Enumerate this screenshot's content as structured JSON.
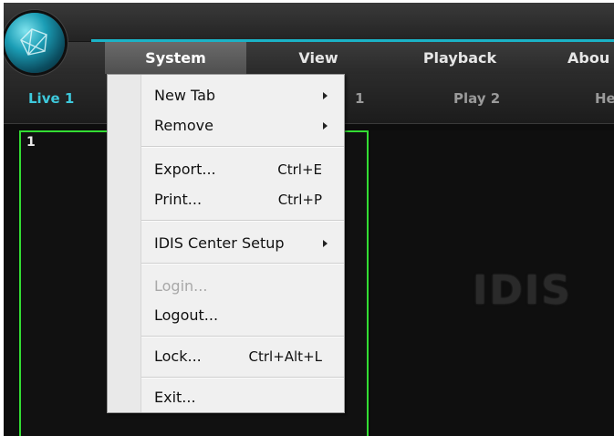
{
  "menubar": {
    "items": [
      {
        "label": "System"
      },
      {
        "label": "View"
      },
      {
        "label": "Playback"
      },
      {
        "label": "Abou"
      }
    ]
  },
  "tabs": [
    {
      "label": "Live 1"
    },
    {
      "label": "1"
    },
    {
      "label": "Play 2"
    },
    {
      "label": "He"
    }
  ],
  "video": {
    "cell_number": "1",
    "watermark": "IDIS"
  },
  "system_menu": {
    "items": [
      {
        "label": "New Tab",
        "shortcut": ""
      },
      {
        "label": "Remove",
        "shortcut": ""
      },
      {
        "label": "Export...",
        "shortcut": "Ctrl+E"
      },
      {
        "label": "Print...",
        "shortcut": "Ctrl+P"
      },
      {
        "label": "IDIS Center Setup",
        "shortcut": ""
      },
      {
        "label": "Login...",
        "shortcut": ""
      },
      {
        "label": "Logout...",
        "shortcut": ""
      },
      {
        "label": "Lock...",
        "shortcut": "Ctrl+Alt+L"
      },
      {
        "label": "Exit...",
        "shortcut": ""
      }
    ]
  },
  "colors": {
    "accent": "#1bb3c7",
    "active_tab": "#3ec9dc",
    "selected_cell_border": "#33dd33"
  }
}
